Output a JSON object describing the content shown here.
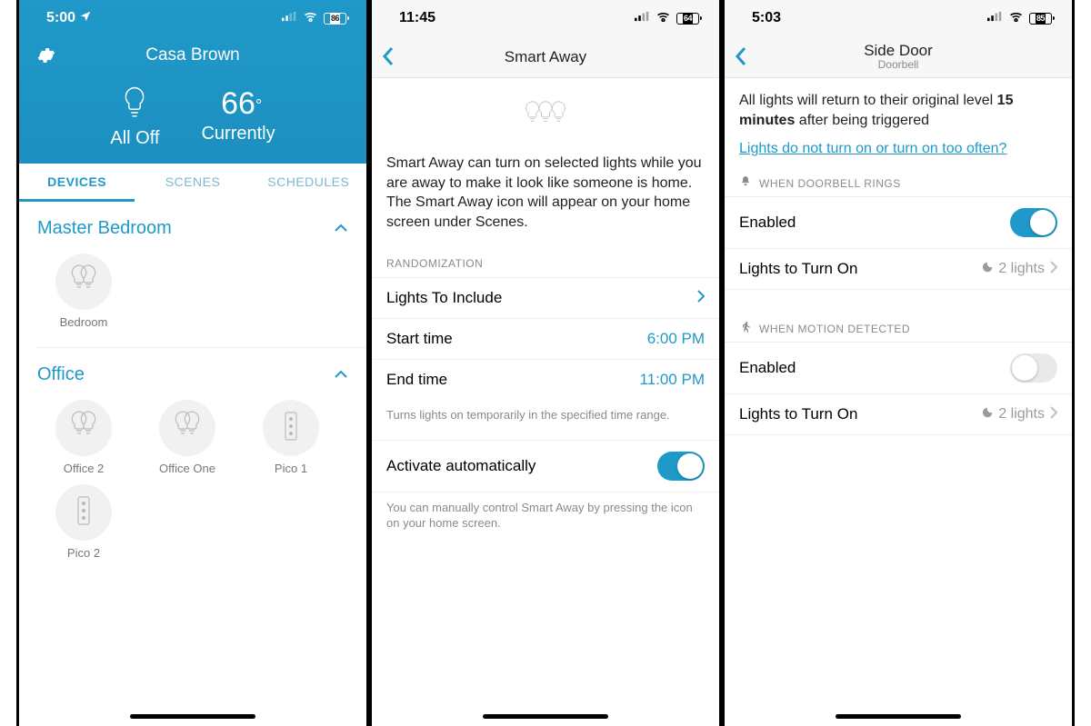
{
  "screen1": {
    "status": {
      "time": "5:00",
      "battery": "86"
    },
    "home_name": "Casa Brown",
    "all_label": "All Off",
    "temp_value": "66",
    "temp_label": "Currently",
    "tabs": {
      "devices": "DEVICES",
      "scenes": "SCENES",
      "schedules": "SCHEDULES"
    },
    "rooms": [
      {
        "name": "Master Bedroom",
        "devices": [
          {
            "label": "Bedroom",
            "kind": "lights"
          }
        ]
      },
      {
        "name": "Office",
        "devices": [
          {
            "label": "Office 2",
            "kind": "lights"
          },
          {
            "label": "Office One",
            "kind": "lights"
          },
          {
            "label": "Pico 1",
            "kind": "pico"
          },
          {
            "label": "Pico 2",
            "kind": "pico"
          }
        ]
      }
    ]
  },
  "screen2": {
    "status": {
      "time": "11:45",
      "battery": "64"
    },
    "title": "Smart Away",
    "desc": "Smart Away can turn on selected lights while you are away to make it look like someone is home.\nThe Smart Away icon will appear on your home screen under Scenes.",
    "section_hdr": "RANDOMIZATION",
    "rows": {
      "include": "Lights To Include",
      "start_label": "Start time",
      "start_val": "6:00 PM",
      "end_label": "End time",
      "end_val": "11:00 PM"
    },
    "section_foot": "Turns lights on temporarily in the specified time range.",
    "activate_label": "Activate automatically",
    "activate_foot": "You can manually control Smart Away by pressing the icon on your home screen."
  },
  "screen3": {
    "status": {
      "time": "5:03",
      "battery": "85"
    },
    "title": "Side Door",
    "subtitle": "Doorbell",
    "top_text_1": "All lights will return to their original level ",
    "top_text_bold": "15 minutes",
    "top_text_2": " after being triggered",
    "faq_link": "Lights do not turn on or turn on too often?",
    "sec1": "WHEN DOORBELL RINGS",
    "enabled_label": "Enabled",
    "lights_label": "Lights to Turn On",
    "lights_value": "2 lights",
    "sec2": "WHEN MOTION DETECTED"
  }
}
